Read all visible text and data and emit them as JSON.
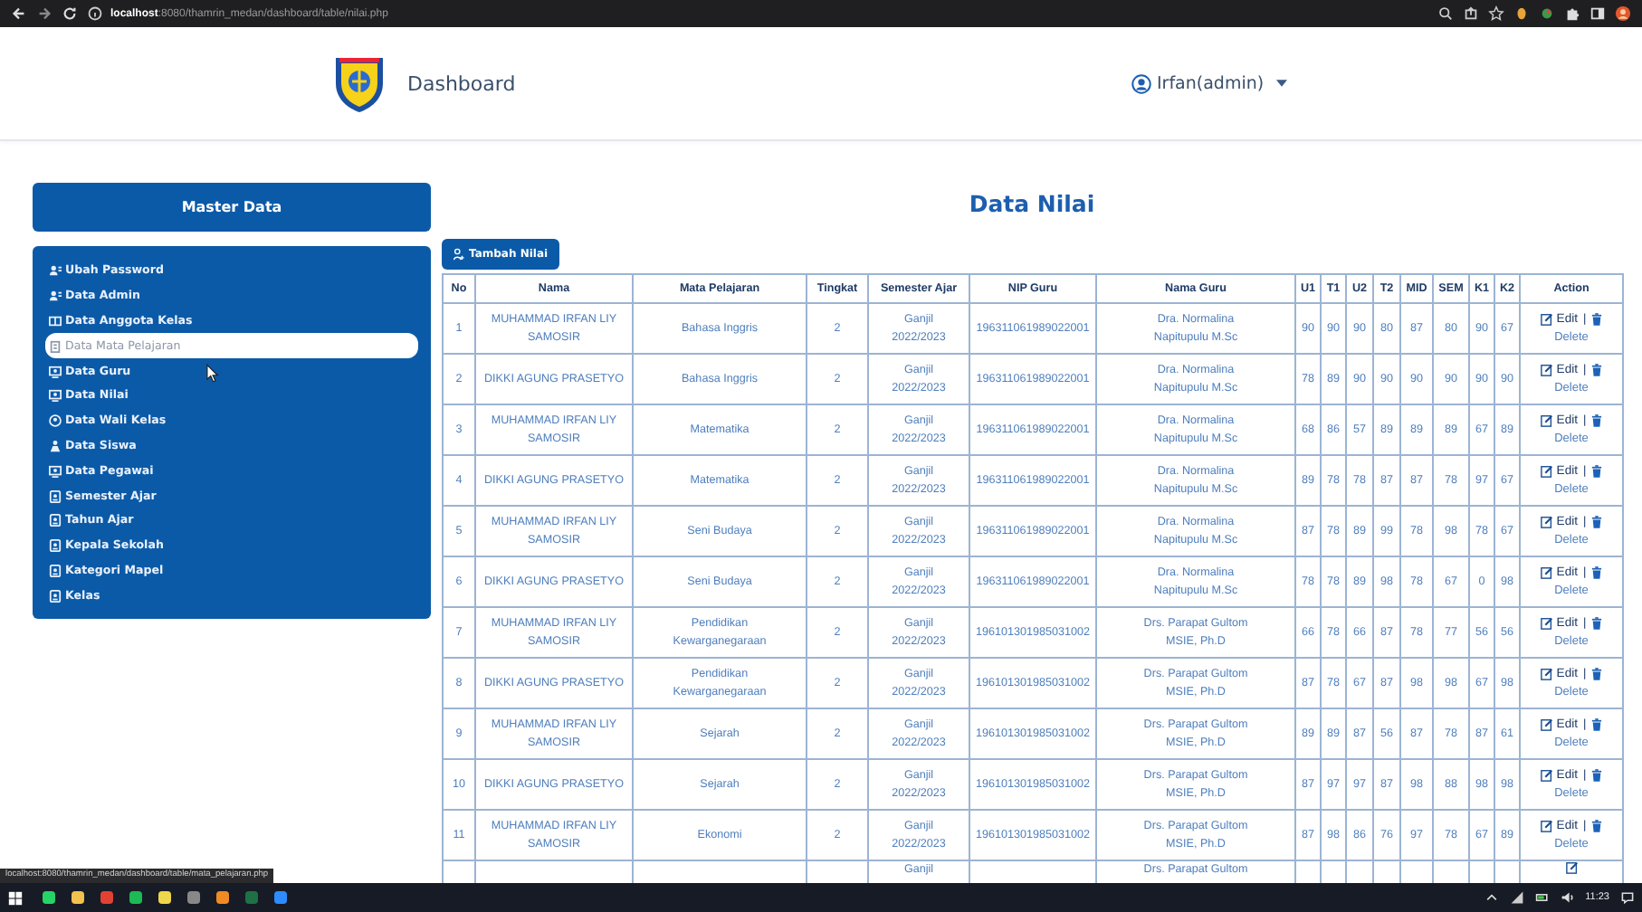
{
  "browser": {
    "url_host": "localhost",
    "url_path": ":8080/thamrin_medan/dashboard/table/nilai.php"
  },
  "header": {
    "title": "Dashboard",
    "user": "Irfan(admin)"
  },
  "sidebar": {
    "title": "Master Data",
    "items": [
      {
        "label": "Ubah Password",
        "selected": false
      },
      {
        "label": "Data Admin",
        "selected": false
      },
      {
        "label": "Data Anggota Kelas",
        "selected": false
      },
      {
        "label": "Data Mata Pelajaran",
        "selected": true
      },
      {
        "label": "Data Guru",
        "selected": false
      },
      {
        "label": "Data Nilai",
        "selected": false
      },
      {
        "label": "Data Wali Kelas",
        "selected": false
      },
      {
        "label": "Data Siswa",
        "selected": false
      },
      {
        "label": "Data Pegawai",
        "selected": false
      },
      {
        "label": "Semester Ajar",
        "selected": false
      },
      {
        "label": "Tahun Ajar",
        "selected": false
      },
      {
        "label": "Kepala Sekolah",
        "selected": false
      },
      {
        "label": "Kategori Mapel",
        "selected": false
      },
      {
        "label": "Kelas",
        "selected": false
      }
    ]
  },
  "main": {
    "title": "Data Nilai",
    "add_button": "Tambah Nilai"
  },
  "table": {
    "columns": [
      "No",
      "Nama",
      "Mata Pelajaran",
      "Tingkat",
      "Semester Ajar",
      "NIP Guru",
      "Nama Guru",
      "U1",
      "T1",
      "U2",
      "T2",
      "MID",
      "SEM",
      "K1",
      "K2",
      "Action"
    ],
    "rows": [
      {
        "no": "1",
        "nama": "MUHAMMAD IRFAN LIY SAMOSIR",
        "mapel": "Bahasa Inggris",
        "tingkat": "2",
        "semester": "Ganjil 2022/2023",
        "nip": "196311061989022001",
        "guru": "Dra. Normalina Napitupulu M.Sc",
        "scores": [
          "90",
          "90",
          "90",
          "80",
          "87",
          "80",
          "90",
          "67"
        ],
        "actions": {
          "edit": "Edit",
          "separator": "|",
          "delete": "Delete"
        }
      },
      {
        "no": "2",
        "nama": "DIKKI AGUNG PRASETYO",
        "mapel": "Bahasa Inggris",
        "tingkat": "2",
        "semester": "Ganjil 2022/2023",
        "nip": "196311061989022001",
        "guru": "Dra. Normalina Napitupulu M.Sc",
        "scores": [
          "78",
          "89",
          "90",
          "90",
          "90",
          "90",
          "90",
          "90"
        ],
        "actions": {
          "edit": "Edit",
          "separator": "|",
          "delete": "Delete"
        }
      },
      {
        "no": "3",
        "nama": "MUHAMMAD IRFAN LIY SAMOSIR",
        "mapel": "Matematika",
        "tingkat": "2",
        "semester": "Ganjil 2022/2023",
        "nip": "196311061989022001",
        "guru": "Dra. Normalina Napitupulu M.Sc",
        "scores": [
          "68",
          "86",
          "57",
          "89",
          "89",
          "89",
          "67",
          "89"
        ],
        "actions": {
          "edit": "Edit",
          "separator": "|",
          "delete": "Delete"
        }
      },
      {
        "no": "4",
        "nama": "DIKKI AGUNG PRASETYO",
        "mapel": "Matematika",
        "tingkat": "2",
        "semester": "Ganjil 2022/2023",
        "nip": "196311061989022001",
        "guru": "Dra. Normalina Napitupulu M.Sc",
        "scores": [
          "89",
          "78",
          "78",
          "87",
          "87",
          "78",
          "97",
          "67"
        ],
        "actions": {
          "edit": "Edit",
          "separator": "|",
          "delete": "Delete"
        }
      },
      {
        "no": "5",
        "nama": "MUHAMMAD IRFAN LIY SAMOSIR",
        "mapel": "Seni Budaya",
        "tingkat": "2",
        "semester": "Ganjil 2022/2023",
        "nip": "196311061989022001",
        "guru": "Dra. Normalina Napitupulu M.Sc",
        "scores": [
          "87",
          "78",
          "89",
          "99",
          "78",
          "98",
          "78",
          "67"
        ],
        "actions": {
          "edit": "Edit",
          "separator": "|",
          "delete": "Delete"
        }
      },
      {
        "no": "6",
        "nama": "DIKKI AGUNG PRASETYO",
        "mapel": "Seni Budaya",
        "tingkat": "2",
        "semester": "Ganjil 2022/2023",
        "nip": "196311061989022001",
        "guru": "Dra. Normalina Napitupulu M.Sc",
        "scores": [
          "78",
          "78",
          "89",
          "98",
          "78",
          "67",
          "0",
          "98"
        ],
        "actions": {
          "edit": "Edit",
          "separator": "|",
          "delete": "Delete"
        }
      },
      {
        "no": "7",
        "nama": "MUHAMMAD IRFAN LIY SAMOSIR",
        "mapel": "Pendidikan Kewarganegaraan",
        "tingkat": "2",
        "semester": "Ganjil 2022/2023",
        "nip": "196101301985031002",
        "guru": "Drs. Parapat Gultom MSIE, Ph.D",
        "scores": [
          "66",
          "78",
          "66",
          "87",
          "78",
          "77",
          "56",
          "56"
        ],
        "actions": {
          "edit": "Edit",
          "separator": "|",
          "delete": "Delete"
        }
      },
      {
        "no": "8",
        "nama": "DIKKI AGUNG PRASETYO",
        "mapel": "Pendidikan Kewarganegaraan",
        "tingkat": "2",
        "semester": "Ganjil 2022/2023",
        "nip": "196101301985031002",
        "guru": "Drs. Parapat Gultom MSIE, Ph.D",
        "scores": [
          "87",
          "78",
          "67",
          "87",
          "98",
          "98",
          "67",
          "98"
        ],
        "actions": {
          "edit": "Edit",
          "separator": "|",
          "delete": "Delete"
        }
      },
      {
        "no": "9",
        "nama": "MUHAMMAD IRFAN LIY SAMOSIR",
        "mapel": "Sejarah",
        "tingkat": "2",
        "semester": "Ganjil 2022/2023",
        "nip": "196101301985031002",
        "guru": "Drs. Parapat Gultom MSIE, Ph.D",
        "scores": [
          "89",
          "89",
          "87",
          "56",
          "87",
          "78",
          "87",
          "61"
        ],
        "actions": {
          "edit": "Edit",
          "separator": "|",
          "delete": "Delete"
        }
      },
      {
        "no": "10",
        "nama": "DIKKI AGUNG PRASETYO",
        "mapel": "Sejarah",
        "tingkat": "2",
        "semester": "Ganjil 2022/2023",
        "nip": "196101301985031002",
        "guru": "Drs. Parapat Gultom MSIE, Ph.D",
        "scores": [
          "87",
          "97",
          "97",
          "87",
          "98",
          "88",
          "98",
          "98"
        ],
        "actions": {
          "edit": "Edit",
          "separator": "|",
          "delete": "Delete"
        }
      },
      {
        "no": "11",
        "nama": "MUHAMMAD IRFAN LIY SAMOSIR",
        "mapel": "Ekonomi",
        "tingkat": "2",
        "semester": "Ganjil 2022/2023",
        "nip": "196101301985031002",
        "guru": "Drs. Parapat Gultom MSIE, Ph.D",
        "scores": [
          "87",
          "98",
          "86",
          "76",
          "97",
          "78",
          "67",
          "89"
        ],
        "actions": {
          "edit": "Edit",
          "separator": "|",
          "delete": "Delete"
        }
      }
    ],
    "cut_row": {
      "semester": "Ganjil",
      "guru": "Drs. Parapat Gultom"
    }
  },
  "link_preview": "localhost:8080/thamrin_medan/dashboard/table/mata_pelajaran.php",
  "taskbar": {
    "time": "11:23"
  }
}
